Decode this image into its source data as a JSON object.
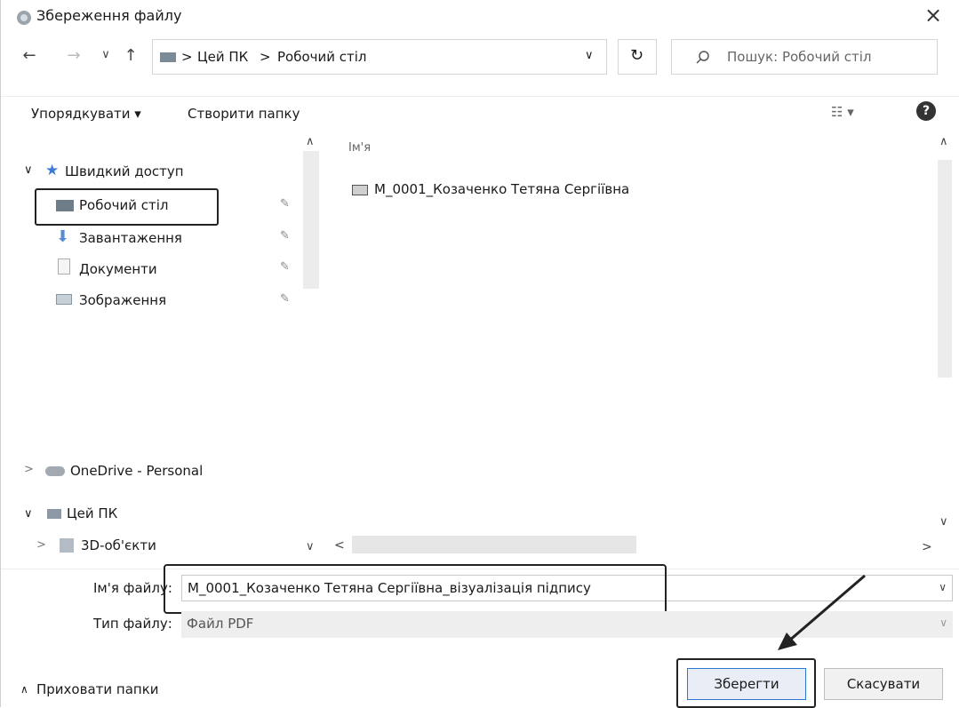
{
  "window": {
    "title": "Збереження файлу",
    "close_glyph": "×"
  },
  "nav": {
    "back": "←",
    "forward": "→",
    "dropdown": "∨",
    "up": "↑",
    "breadcrumb": [
      "Цей ПК",
      "Робочий стіл"
    ],
    "breadcrumb_sep": ">",
    "refresh": "↻",
    "search_placeholder": "Пошук: Робочий стіл"
  },
  "toolbar": {
    "organize": "Упорядкувати ▾",
    "new_folder": "Створити папку",
    "view": "☷ ▾",
    "help": "?"
  },
  "sidebar": {
    "quick_access": "Швидкий доступ",
    "items": [
      {
        "label": "Робочий стіл",
        "icon": "desktop-icon"
      },
      {
        "label": "Завантаження",
        "icon": "download-icon"
      },
      {
        "label": "Документи",
        "icon": "documents-icon"
      },
      {
        "label": "Зображення",
        "icon": "pictures-icon"
      }
    ],
    "onedrive": "OneDrive - Personal",
    "this_pc": "Цей ПК",
    "objects3d": "3D-об'єкти"
  },
  "files": {
    "column_header": "Ім'я",
    "items": [
      {
        "name": "M_0001_Козаченко Тетяна Сергіївна",
        "icon": "file-icon"
      }
    ]
  },
  "form": {
    "filename_label": "Ім'я файлу:",
    "filename_value": "M_0001_Козаченко Тетяна Сергіївна_візуалізація підпису",
    "filetype_label": "Тип файлу:",
    "filetype_value": "Файл PDF"
  },
  "footer": {
    "hide_folders": "Приховати папки",
    "save": "Зберегти",
    "cancel": "Скасувати"
  },
  "colors": {
    "accent": "#2b76d2",
    "highlight_box": "#222222"
  }
}
